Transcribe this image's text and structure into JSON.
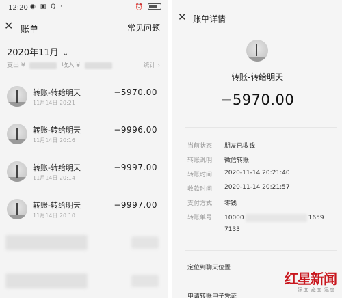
{
  "left": {
    "status": {
      "time": "12:20",
      "icons": "◉ ▣ Q ·",
      "right_icons": "⏰ ▐"
    },
    "nav": {
      "close": "✕",
      "title": "账单",
      "help": "常见问题"
    },
    "month": {
      "label": "2020年11月",
      "chevron": "⌄"
    },
    "summary": {
      "expense_label": "支出 ¥",
      "income_label": "收入 ¥",
      "stats": "统计 ›"
    },
    "transactions": [
      {
        "title": "转账-转给明天",
        "date": "11月14日 20:21",
        "amount": "−5970.00"
      },
      {
        "title": "转账-转给明天",
        "date": "11月14日 20:16",
        "amount": "−9996.00"
      },
      {
        "title": "转账-转给明天",
        "date": "11月14日 20:14",
        "amount": "−9997.00"
      },
      {
        "title": "转账-转给明天",
        "date": "11月14日 20:10",
        "amount": "−9997.00"
      }
    ]
  },
  "right": {
    "nav": {
      "close": "✕",
      "title": "账单详情"
    },
    "payee": "转账-转给明天",
    "amount": "−5970.00",
    "details": [
      {
        "label": "当前状态",
        "value": "朋友已收钱"
      },
      {
        "label": "转账说明",
        "value": "微信转账"
      },
      {
        "label": "转账时间",
        "value": "2020-11-14 20:21:40"
      },
      {
        "label": "收款时间",
        "value": "2020-11-14 20:21:57"
      },
      {
        "label": "支付方式",
        "value": "零钱"
      }
    ],
    "txno": {
      "label": "转账单号",
      "prefix": "10000",
      "suffix": "1659",
      "line2": "7133"
    },
    "locate": "定位到聊天位置",
    "apply": "申请转账电子凭证"
  },
  "watermark": {
    "main": "红星新闻",
    "sub": "深度 态度 温度"
  }
}
